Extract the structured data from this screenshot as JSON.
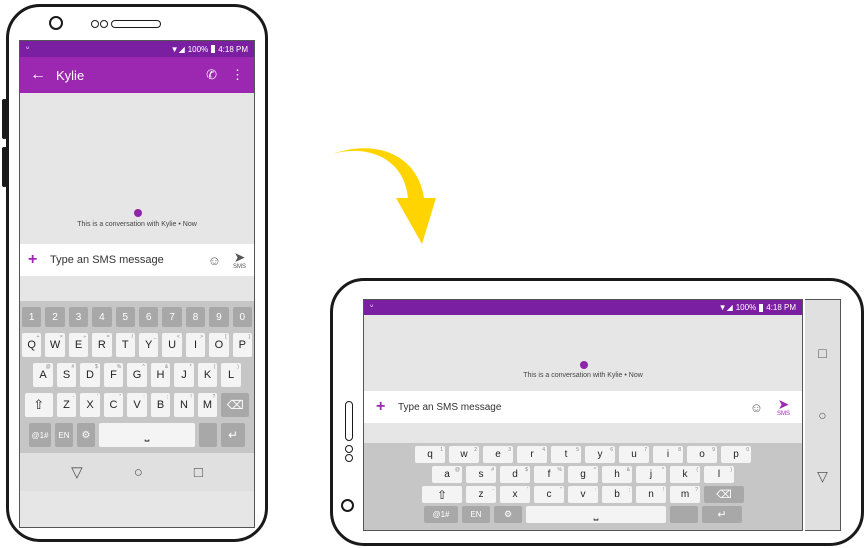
{
  "status": {
    "signal": "▼◢",
    "battery_pct": "100%",
    "time": "4:18 PM",
    "notif": "ᐡ"
  },
  "conversation": {
    "contact_name": "Kylie",
    "info_text": "This is a conversation with Kylie • Now",
    "compose_placeholder": "Type an SMS message",
    "send_label": "SMS"
  },
  "icons": {
    "back": "←",
    "phone": "✆",
    "more": "⋮",
    "plus": "+",
    "emoji": "☺",
    "send": "➤",
    "shift": "⇧",
    "backspace": "⌫",
    "enter": "↵",
    "settings": "⚙",
    "space": "⎵",
    "nav_back": "▽",
    "nav_home": "○",
    "nav_recent": "□"
  },
  "keyboard_portrait": {
    "numbers": [
      "1",
      "2",
      "3",
      "4",
      "5",
      "6",
      "7",
      "8",
      "9",
      "0"
    ],
    "row1": [
      "Q",
      "W",
      "E",
      "R",
      "T",
      "Y",
      "U",
      "I",
      "O",
      "P"
    ],
    "row1_hints": [
      "+",
      "×",
      "÷",
      "=",
      "/",
      "_",
      "<",
      ">",
      "[",
      "]"
    ],
    "row2": [
      "A",
      "S",
      "D",
      "F",
      "G",
      "H",
      "J",
      "K",
      "L"
    ],
    "row2_hints": [
      "@",
      "#",
      "$",
      "%",
      "^",
      "&",
      "*",
      "(",
      ")"
    ],
    "row3": [
      "Z",
      "X",
      "C",
      "V",
      "B",
      "N",
      "M"
    ],
    "row3_hints": [
      "-",
      "'",
      "\"",
      ":",
      ";",
      "!",
      "?"
    ],
    "sym_key": "@1#",
    "lang_key": "EN"
  },
  "keyboard_landscape": {
    "row1": [
      "q",
      "w",
      "e",
      "r",
      "t",
      "y",
      "u",
      "i",
      "o",
      "p"
    ],
    "row1_hints": [
      "1",
      "2",
      "3",
      "4",
      "5",
      "6",
      "7",
      "8",
      "9",
      "0"
    ],
    "row2": [
      "a",
      "s",
      "d",
      "f",
      "g",
      "h",
      "j",
      "k",
      "l"
    ],
    "row2_hints": [
      "@",
      "#",
      "$",
      "%",
      "^",
      "&",
      "*",
      "(",
      ")"
    ],
    "row3": [
      "z",
      "x",
      "c",
      "v",
      "b",
      "n",
      "m"
    ],
    "row3_hints": [
      "-",
      "'",
      "\"",
      ":",
      ";",
      "!",
      "?"
    ],
    "sym_key": "@1#",
    "lang_key": "EN"
  },
  "colors": {
    "appbar": "#9c27b0",
    "statusbar": "#7b1fa2",
    "accent": "#8e24aa",
    "arrow": "#ffd400"
  }
}
